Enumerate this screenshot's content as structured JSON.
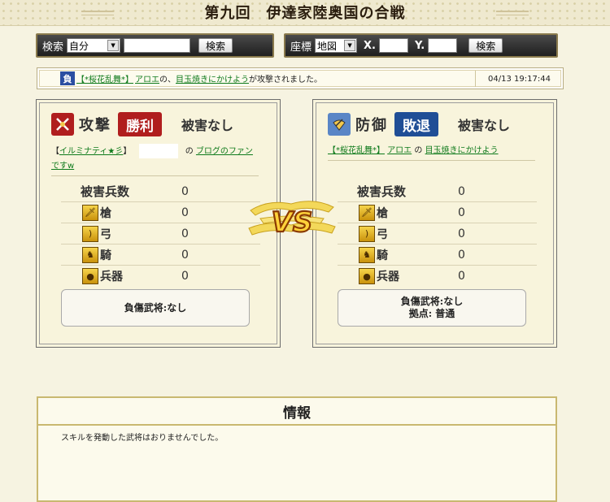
{
  "page": {
    "title": "第九回　伊達家陸奥国の合戦"
  },
  "search_bar": {
    "label": "検索",
    "select_value": "自分",
    "input_value": "",
    "button_label": "検索"
  },
  "coord_bar": {
    "label": "座標",
    "select_value": "地図",
    "x_label": "X.",
    "y_label": "Y.",
    "x_value": "",
    "y_value": "",
    "button_label": "検索"
  },
  "log": {
    "badge": "負",
    "alliance": "【*桜花乱舞*】",
    "player": "アロエ",
    "of": " の、",
    "territory": "目玉焼きにかけよう",
    "message": " が攻撃されました。",
    "time": "04/13 19:17:44"
  },
  "attacker": {
    "role": "攻撃",
    "result": "勝利",
    "damage": "被害なし",
    "alliance_open": "【",
    "alliance": "イルミナティ★彡",
    "alliance_close": "】",
    "player": "",
    "of": "の",
    "territory": "ブログのファンですw",
    "stats": [
      {
        "label": "被害兵数",
        "value": "0"
      },
      {
        "label": "槍",
        "value": "0"
      },
      {
        "label": "弓",
        "value": "0"
      },
      {
        "label": "騎",
        "value": "0"
      },
      {
        "label": "兵器",
        "value": "0"
      }
    ],
    "wounded": "負傷武将:なし"
  },
  "defender": {
    "role": "防御",
    "result": "敗退",
    "damage": "被害なし",
    "alliance": "【*桜花乱舞*】",
    "player": "アロエ",
    "of": "の",
    "territory": "目玉焼きにかけよう",
    "stats": [
      {
        "label": "被害兵数",
        "value": "0"
      },
      {
        "label": "槍",
        "value": "0"
      },
      {
        "label": "弓",
        "value": "0"
      },
      {
        "label": "騎",
        "value": "0"
      },
      {
        "label": "兵器",
        "value": "0"
      }
    ],
    "wounded": "負傷武将:なし",
    "base": "拠点: 普通"
  },
  "vs_label": "VS",
  "info": {
    "title": "情報",
    "body": "スキルを発動した武将はおりませんでした。"
  },
  "colors": {
    "win": "#b01e1e",
    "lose": "#1f4e96",
    "link": "#0e7a1b"
  }
}
